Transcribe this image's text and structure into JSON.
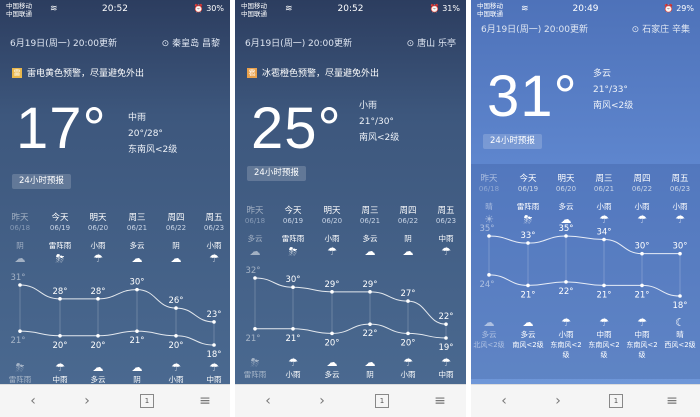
{
  "nav": {
    "back_icon": "‹",
    "forward_icon": "›",
    "tabs_count": "1",
    "menu_icon": "≡"
  },
  "panels": [
    {
      "status": {
        "carrier1": "中国移动",
        "carrier2": "中国联通",
        "time": "20:52",
        "battery": "30%"
      },
      "updated": "6月19日(周一) 20:00更新",
      "location": "秦皇岛 昌黎",
      "alert": {
        "icon": "雷",
        "text": "雷电黄色预警，尽量避免外出",
        "color": "#e9b74c"
      },
      "temp": "17°",
      "condition": "中雨",
      "range": "20°/28°",
      "wind": "东南风<2级",
      "forecast_btn": "24小时预报",
      "days": [
        {
          "day": "昨天",
          "date": "06/18",
          "cond": "阴",
          "icon": "☁",
          "high": "31°",
          "low": "21°",
          "ncond": "雷阵雨",
          "nicon": "⛈",
          "past": true
        },
        {
          "day": "今天",
          "date": "06/19",
          "cond": "雷阵雨",
          "icon": "⛈",
          "high": "28°",
          "low": "20°",
          "ncond": "中雨",
          "nicon": "☂",
          "past": false
        },
        {
          "day": "明天",
          "date": "06/20",
          "cond": "小雨",
          "icon": "☂",
          "high": "28°",
          "low": "20°",
          "ncond": "多云",
          "nicon": "☁",
          "past": false
        },
        {
          "day": "周三",
          "date": "06/21",
          "cond": "多云",
          "icon": "☁",
          "high": "30°",
          "low": "21°",
          "ncond": "阴",
          "nicon": "☁",
          "past": false
        },
        {
          "day": "周四",
          "date": "06/22",
          "cond": "阴",
          "icon": "☁",
          "high": "26°",
          "low": "20°",
          "ncond": "小雨",
          "nicon": "☂",
          "past": false
        },
        {
          "day": "周五",
          "date": "06/23",
          "cond": "小雨",
          "icon": "☂",
          "high": "23°",
          "low": "18°",
          "ncond": "中雨",
          "nicon": "☂",
          "past": false
        }
      ]
    },
    {
      "status": {
        "carrier1": "中国移动",
        "carrier2": "中国联通",
        "time": "20:52",
        "battery": "31%"
      },
      "updated": "6月19日(周一) 20:00更新",
      "location": "唐山 乐亭",
      "alert": {
        "icon": "雹",
        "text": "冰雹橙色预警，尽量避免外出",
        "color": "#e9a14c"
      },
      "temp": "25°",
      "condition": "小雨",
      "range": "21°/30°",
      "wind": "南风<2级",
      "forecast_btn": "24小时预报",
      "days": [
        {
          "day": "昨天",
          "date": "06/18",
          "cond": "多云",
          "icon": "☁",
          "high": "32°",
          "low": "21°",
          "ncond": "雷阵雨",
          "nicon": "⛈",
          "past": true
        },
        {
          "day": "今天",
          "date": "06/19",
          "cond": "雷阵雨",
          "icon": "⛈",
          "high": "30°",
          "low": "21°",
          "ncond": "小雨",
          "nicon": "☂",
          "past": false
        },
        {
          "day": "明天",
          "date": "06/20",
          "cond": "小雨",
          "icon": "☂",
          "high": "29°",
          "low": "20°",
          "ncond": "多云",
          "nicon": "☁",
          "past": false
        },
        {
          "day": "周三",
          "date": "06/21",
          "cond": "多云",
          "icon": "☁",
          "high": "29°",
          "low": "22°",
          "ncond": "阴",
          "nicon": "☁",
          "past": false
        },
        {
          "day": "周四",
          "date": "06/22",
          "cond": "阴",
          "icon": "☁",
          "high": "27°",
          "low": "20°",
          "ncond": "小雨",
          "nicon": "☂",
          "past": false
        },
        {
          "day": "周五",
          "date": "06/23",
          "cond": "中雨",
          "icon": "☂",
          "high": "22°",
          "low": "19°",
          "ncond": "中雨",
          "nicon": "☂",
          "past": false
        }
      ]
    },
    {
      "status": {
        "carrier1": "中国移动",
        "carrier2": "中国联通",
        "time": "20:49",
        "battery": "29%"
      },
      "updated": "6月19日(周一) 20:00更新",
      "location": "石家庄 辛集",
      "temp": "31°",
      "condition": "多云",
      "range": "21°/33°",
      "wind": "南风<2级",
      "forecast_btn": "24小时预报",
      "days": [
        {
          "day": "昨天",
          "date": "06/18",
          "cond": "晴",
          "icon": "☀",
          "high": "35°",
          "low": "24°",
          "ncond": "多云",
          "nicon": "☁",
          "wind": "北风<2级",
          "past": true
        },
        {
          "day": "今天",
          "date": "06/19",
          "cond": "雷阵雨",
          "icon": "⛈",
          "high": "33°",
          "low": "21°",
          "ncond": "多云",
          "nicon": "☁",
          "wind": "南风<2级",
          "past": false
        },
        {
          "day": "明天",
          "date": "06/20",
          "cond": "多云",
          "icon": "☁",
          "high": "35°",
          "low": "22°",
          "ncond": "小雨",
          "nicon": "☂",
          "wind": "东南风<2级",
          "past": false
        },
        {
          "day": "周三",
          "date": "06/21",
          "cond": "小雨",
          "icon": "☂",
          "high": "34°",
          "low": "21°",
          "ncond": "中雨",
          "nicon": "☂",
          "wind": "东南风<2级",
          "past": false
        },
        {
          "day": "周四",
          "date": "06/22",
          "cond": "小雨",
          "icon": "☂",
          "high": "30°",
          "low": "21°",
          "ncond": "中雨",
          "nicon": "☂",
          "wind": "东南风<2级",
          "past": false
        },
        {
          "day": "周五",
          "date": "06/23",
          "cond": "小雨",
          "icon": "☂",
          "high": "30°",
          "low": "18°",
          "ncond": "晴",
          "nicon": "☾",
          "wind": "西风<2级",
          "past": false
        }
      ]
    }
  ]
}
